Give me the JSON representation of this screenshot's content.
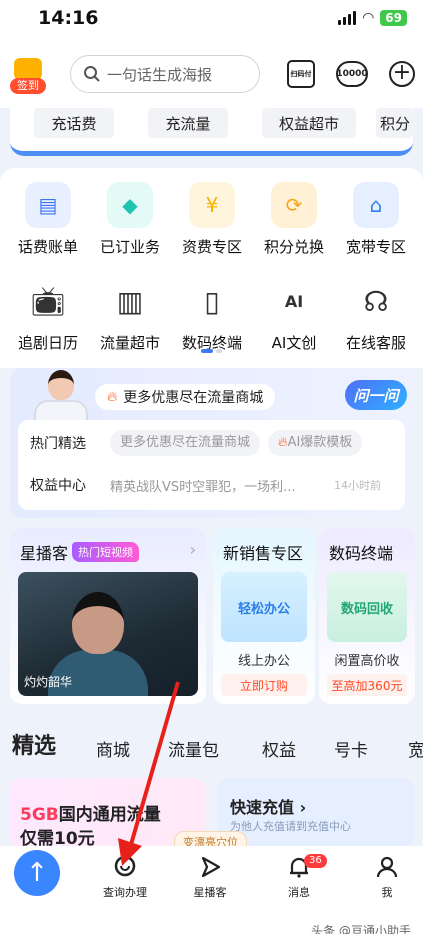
{
  "status": {
    "time": "14:16",
    "battery": "69"
  },
  "header": {
    "checkin": "签到",
    "search_placeholder": "一句话生成海报",
    "scan_label": "扫码付",
    "service_label": "10000"
  },
  "quick_buttons": [
    "充话费",
    "充流量",
    "权益超市",
    "积分"
  ],
  "services": [
    {
      "label": "话费账单",
      "icon": "bill-icon",
      "color": "#3d74f0"
    },
    {
      "label": "已订业务",
      "icon": "subscribed-icon",
      "color": "#1fc3b0"
    },
    {
      "label": "资费专区",
      "icon": "tariff-icon",
      "color": "#f5b400"
    },
    {
      "label": "积分兑换",
      "icon": "points-icon",
      "color": "#f7a51c"
    },
    {
      "label": "宽带专区",
      "icon": "router-icon",
      "color": "#2f7df6"
    },
    {
      "label": "追剧日历",
      "icon": "tv-icon",
      "color": "#333333"
    },
    {
      "label": "流量超市",
      "icon": "shop-icon",
      "color": "#333333"
    },
    {
      "label": "数码终端",
      "icon": "phone-icon",
      "color": "#333333"
    },
    {
      "label": "AI文创",
      "icon": "ai-icon",
      "color": "#333333"
    },
    {
      "label": "在线客服",
      "icon": "headset-icon",
      "color": "#333333"
    }
  ],
  "promo": {
    "bubble": "更多优惠尽在流量商城",
    "ask_button": "问一问",
    "row1_title": "热门精选",
    "row1_tag1": "更多优惠尽在流量商城",
    "row1_tag2": "AI爆款模板",
    "row2_title": "权益中心",
    "row2_news": "精英战队VS时空罪犯，一场利...",
    "row2_time": "14小时前"
  },
  "features": {
    "xingbo": {
      "title": "星播客",
      "badge": "热门短视频",
      "caption": "灼灼韶华"
    },
    "new_sales": {
      "title": "新销售专区",
      "image_text": "轻松办公",
      "label": "线上办公",
      "tag": "立即订购"
    },
    "digital": {
      "title": "数码终端",
      "image_text": "数码回收",
      "label": "闲置高价收",
      "tag": "至高加360元"
    }
  },
  "categories": [
    "精选",
    "商城",
    "流量包",
    "权益",
    "号卡",
    "宽"
  ],
  "bottom_cards": {
    "left_line1_highlight": "5GB",
    "left_line1": "国内通用流量",
    "left_line2": "仅需10元",
    "right_title": "快速充值",
    "right_sub": "为他人充值请到充值中心"
  },
  "float_tip": "变漂亮穴位",
  "tabbar": [
    {
      "label": "查询办理",
      "icon": "search-chat-icon"
    },
    {
      "label": "星播客",
      "icon": "play-icon"
    },
    {
      "label": "消息",
      "icon": "bell-icon",
      "badge": "36"
    },
    {
      "label": "我",
      "icon": "person-icon"
    }
  ],
  "watermark": "头条 @亘通小助手"
}
